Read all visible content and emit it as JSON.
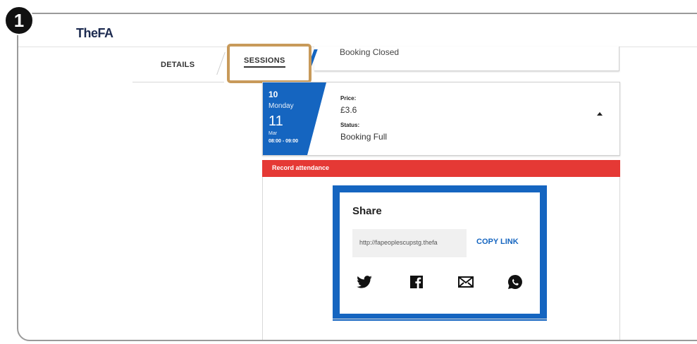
{
  "step_badge": "1",
  "header": {
    "logo": "TheFA"
  },
  "tabs": [
    {
      "label": "DETAILS",
      "active": false
    },
    {
      "label": "SESSIONS",
      "active": true
    }
  ],
  "status_banner": {
    "text": "Booking Closed"
  },
  "session": {
    "number": "10",
    "weekday": "Monday",
    "day": "11",
    "month": "Mar",
    "time": "08:00 - 09:00",
    "price_label": "Price:",
    "price_value": "£3.6",
    "status_label": "Status:",
    "status_value": "Booking Full",
    "toggle_icon": "chevron-up-icon"
  },
  "record_attendance": {
    "label": "Record attendance"
  },
  "share": {
    "title": "Share",
    "link": "http://fapeoplescupstg.thefa",
    "copy_label": "COPY LINK",
    "icons": [
      "twitter-icon",
      "facebook-icon",
      "email-icon",
      "whatsapp-icon"
    ]
  },
  "colors": {
    "brand_blue": "#1565c0",
    "alert_red": "#e53935",
    "highlight_border": "#c89a5a",
    "logo_navy": "#1d2b50"
  }
}
